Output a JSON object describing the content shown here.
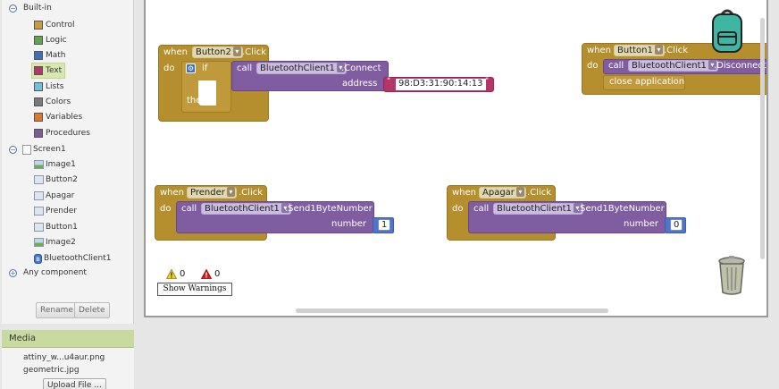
{
  "blocks_tree": {
    "builtin_label": "Built-in",
    "builtin_items": [
      {
        "label": "Control",
        "color": "#c89b3c"
      },
      {
        "label": "Logic",
        "color": "#5da64e"
      },
      {
        "label": "Math",
        "color": "#3f71b8"
      },
      {
        "label": "Text",
        "color": "#b5346a"
      },
      {
        "label": "Lists",
        "color": "#6cc3e0"
      },
      {
        "label": "Colors",
        "color": "#7a7a7a"
      },
      {
        "label": "Variables",
        "color": "#e3742a"
      },
      {
        "label": "Procedures",
        "color": "#7d5a9a"
      }
    ],
    "screen_label": "Screen1",
    "components": [
      {
        "label": "Image1",
        "icon": "image-icon"
      },
      {
        "label": "Button2",
        "icon": "button-icon"
      },
      {
        "label": "Apagar",
        "icon": "button-icon"
      },
      {
        "label": "Prender",
        "icon": "button-icon"
      },
      {
        "label": "Button1",
        "icon": "button-icon"
      },
      {
        "label": "Image2",
        "icon": "image-icon"
      },
      {
        "label": "BluetoothClient1",
        "icon": "bluetooth-icon"
      }
    ],
    "any_component_label": "Any component",
    "rename_label": "Rename",
    "delete_label": "Delete"
  },
  "media": {
    "header": "Media",
    "files": [
      "attiny_w...u4aur.png",
      "geometric.jpg"
    ],
    "upload_label": "Upload File ..."
  },
  "blocks": {
    "b1": {
      "when": "when",
      "component": "Button2",
      "event": ".Click",
      "do": "do",
      "if": "if",
      "then": "then",
      "call": "call",
      "target": "BluetoothClient1",
      "method": ".Connect",
      "param": "address",
      "value": "98:D3:31:90:14:13"
    },
    "b2": {
      "when": "when",
      "component": "Button1",
      "event": ".Click",
      "do": "do",
      "call": "call",
      "target": "BluetoothClient1",
      "method": ".Disconnect",
      "close": "close application"
    },
    "b3": {
      "when": "when",
      "component": "Prender",
      "event": ".Click",
      "do": "do",
      "call": "call",
      "target": "BluetoothClient1",
      "method": ".Send1ByteNumber",
      "param": "number",
      "value": "1"
    },
    "b4": {
      "when": "when",
      "component": "Apagar",
      "event": ".Click",
      "do": "do",
      "call": "call",
      "target": "BluetoothClient1",
      "method": ".Send1ByteNumber",
      "param": "number",
      "value": "0"
    }
  },
  "warnings": {
    "warning_count": "0",
    "error_count": "0",
    "show_label": "Show Warnings"
  }
}
